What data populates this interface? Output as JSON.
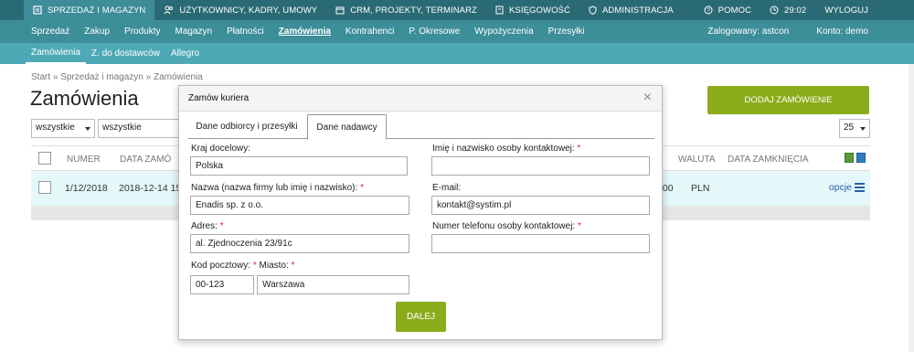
{
  "topbar": {
    "items": [
      {
        "label": "SPRZEDAŻ I MAGAZYN",
        "icon": "folder-icon"
      },
      {
        "label": "UŻYTKOWNICY, KADRY, UMOWY",
        "icon": "users-icon"
      },
      {
        "label": "CRM, PROJEKTY, TERMINARZ",
        "icon": "calendar-icon"
      },
      {
        "label": "KSIĘGOWOŚĆ",
        "icon": "document-icon"
      },
      {
        "label": "ADMINISTRACJA",
        "icon": "shield-icon"
      }
    ],
    "help": "POMOC",
    "time": "29:02",
    "logout": "WYLOGUJ"
  },
  "nav2": {
    "items": [
      "Sprzedaż",
      "Zakup",
      "Produkty",
      "Magazyn",
      "Płatności",
      "Zamówienia",
      "Kontrahenci",
      "P. Okresowe",
      "Wypożyczenia",
      "Przesyłki"
    ],
    "active": "Zamówienia",
    "logged": "Zalogowany: astcon",
    "account": "Konto: demo"
  },
  "nav3": {
    "items": [
      "Zamówienia",
      "Z. do dostawców",
      "Allegro"
    ]
  },
  "breadcrumb": "Start » Sprzedaż i magazyn » Zamówienia",
  "page_title": "Zamówienia",
  "add_button": "DODAJ ZAMÓWIENIE",
  "filters": {
    "select1": "wszystkie",
    "select2": "wszystkie",
    "per_page": "25"
  },
  "table": {
    "headers": {
      "numer": "NUMER",
      "data": "DATA ZAMÓ",
      "waluta": "WALUTA",
      "data_zamkniecia": "DATA ZAMKNIĘCIA"
    },
    "row": {
      "numer": "1/12/2018",
      "data": "2018-12-14 15:0",
      "kwota": ",00",
      "waluta": "PLN",
      "opcje": "opcje"
    }
  },
  "modal": {
    "title": "Zamów kuriera",
    "tabs": [
      "Dane odbiorcy i przesyłki",
      "Dane nadawcy"
    ],
    "active_tab": "Dane nadawcy",
    "fields": {
      "kraj": {
        "label": "Kraj docelowy:",
        "value": "Polska"
      },
      "nazwa": {
        "label": "Nazwa (nazwa firmy lub imię i nazwisko):",
        "value": "Enadis sp. z o.o."
      },
      "adres": {
        "label": "Adres:",
        "value": "al. Zjednoczenia 23/91c"
      },
      "kod": {
        "label": "Kod pocztowy:",
        "value": "00-123"
      },
      "miasto": {
        "label": "Miasto:",
        "value": "Warszawa"
      },
      "osoba": {
        "label": "Imię i nazwisko osoby kontaktowej:",
        "value": ""
      },
      "email": {
        "label": "E-mail:",
        "value": "kontakt@systim.pl"
      },
      "telefon": {
        "label": "Numer telefonu osoby kontaktowej:",
        "value": ""
      }
    },
    "required_mark": "*",
    "next_button": "DALEJ",
    "close_glyph": "×"
  }
}
